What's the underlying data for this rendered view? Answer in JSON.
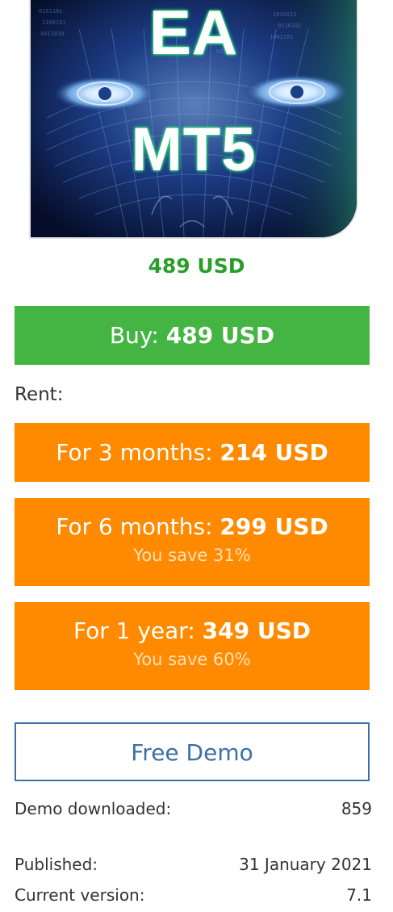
{
  "image": {
    "line1": "EA",
    "line2": "MT5"
  },
  "price": "489 USD",
  "buy": {
    "prefix": "Buy: ",
    "amount": "489 USD"
  },
  "rent": {
    "label": "Rent:",
    "options": [
      {
        "prefix": "For 3 months: ",
        "amount": "214 USD",
        "save": ""
      },
      {
        "prefix": "For 6 months: ",
        "amount": "299 USD",
        "save": "You save 31%"
      },
      {
        "prefix": "For 1 year: ",
        "amount": "349 USD",
        "save": "You save 60%"
      }
    ]
  },
  "demo": {
    "label": "Free Demo"
  },
  "info": {
    "downloads_label": "Demo downloaded:",
    "downloads_value": "859",
    "published_label": "Published:",
    "published_value": "31 January 2021",
    "version_label": "Current version:",
    "version_value": "7.1"
  },
  "colors": {
    "price_green": "#2a9d2a",
    "buy_green": "#44b543",
    "rent_orange": "#ff8a00",
    "demo_blue": "#3d6fa8"
  }
}
